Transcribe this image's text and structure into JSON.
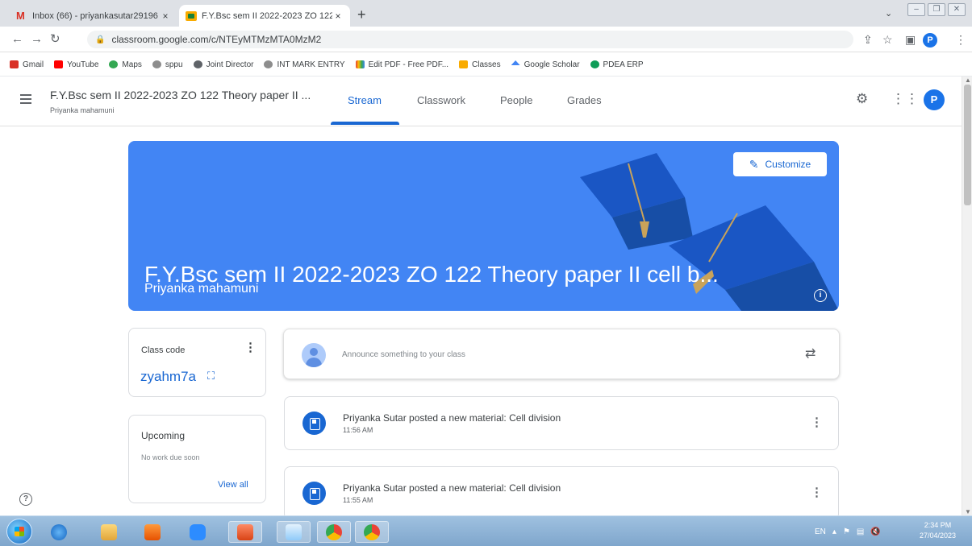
{
  "browser": {
    "tabs": [
      {
        "title": "Inbox (66) - priyankasutar29196",
        "close": "×"
      },
      {
        "title": "F.Y.Bsc sem II 2022-2023 ZO 122",
        "close": "×"
      }
    ],
    "new_tab": "+",
    "url": "classroom.google.com/c/NTEyMTMzMTA0MzM2",
    "profile_initial": "P",
    "bookmarks": [
      "Gmail",
      "YouTube",
      "Maps",
      "sppu",
      "Joint Director",
      "INT MARK ENTRY",
      "Edit PDF - Free PDF...",
      "Classes",
      "Google Scholar",
      "PDEA ERP"
    ]
  },
  "header": {
    "course_title": "F.Y.Bsc sem II 2022-2023 ZO 122 Theory paper II ...",
    "course_subtitle": "Priyanka mahamuni",
    "tabs": [
      "Stream",
      "Classwork",
      "People",
      "Grades"
    ],
    "active_tab": "Stream",
    "avatar_initial": "P"
  },
  "banner": {
    "title": "F.Y.Bsc sem II 2022-2023 ZO 122 Theory paper II cell b...",
    "subtitle": "Priyanka mahamuni",
    "customize_label": "Customize",
    "color": "#4285f4"
  },
  "class_code": {
    "label": "Class code",
    "code": "zyahm7a"
  },
  "upcoming": {
    "title": "Upcoming",
    "empty_text": "No work due soon",
    "view_all": "View all"
  },
  "stream": {
    "announce_placeholder": "Announce something to your class",
    "posts": [
      {
        "text": "Priyanka Sutar posted a new material: Cell division",
        "time": "11:56 AM"
      },
      {
        "text": "Priyanka Sutar posted a new material: Cell division",
        "time": "11:55 AM"
      }
    ]
  },
  "taskbar": {
    "language": "EN",
    "time": "2:34 PM",
    "date": "27/04/2023"
  },
  "colors": {
    "accent": "#1967d2",
    "banner": "#4285f4"
  }
}
